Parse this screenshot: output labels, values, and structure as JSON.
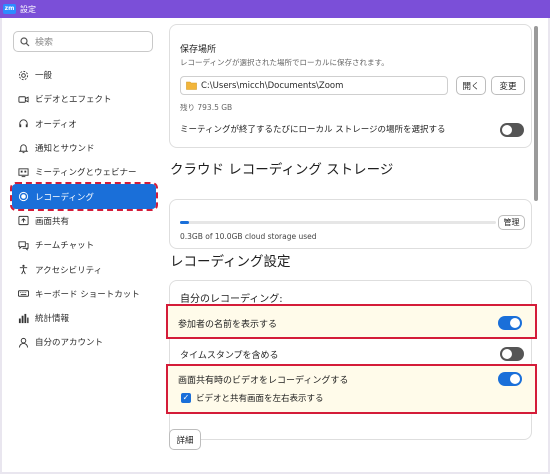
{
  "titlebar": {
    "logo": "zm",
    "title": "設定"
  },
  "sidebar": {
    "search_placeholder": "検索",
    "items": [
      {
        "label": "一般",
        "icon": "gear-icon"
      },
      {
        "label": "ビデオとエフェクト",
        "icon": "video-camera-icon"
      },
      {
        "label": "オーディオ",
        "icon": "headphones-icon"
      },
      {
        "label": "通知とサウンド",
        "icon": "bell-icon"
      },
      {
        "label": "ミーティングとウェビナー",
        "icon": "meeting-icon"
      },
      {
        "label": "レコーディング",
        "icon": "record-icon",
        "active": true
      },
      {
        "label": "画面共有",
        "icon": "screen-share-icon"
      },
      {
        "label": "チームチャット",
        "icon": "chat-icon"
      },
      {
        "label": "アクセシビリティ",
        "icon": "accessibility-icon"
      },
      {
        "label": "キーボード ショートカット",
        "icon": "keyboard-icon"
      },
      {
        "label": "統計情報",
        "icon": "stats-icon"
      },
      {
        "label": "自分のアカウント",
        "icon": "account-icon"
      }
    ]
  },
  "local": {
    "location_label": "保存場所",
    "location_desc": "レコーディングが選択された場所でローカルに保存されます。",
    "path": "C:\\Users\\micch\\Documents\\Zoom",
    "open_button": "開く",
    "change_button": "変更",
    "remaining": "残り 793.5 GB",
    "choose_location_label": "ミーティングが終了するたびにローカル ストレージの場所を選択する",
    "choose_location_on": false
  },
  "cloud": {
    "heading": "クラウド レコーディング ストレージ",
    "usage_text": "0.3GB of 10.0GB cloud storage used",
    "usage_fraction": 0.03,
    "manage_button": "管理"
  },
  "recording": {
    "heading": "レコーディング設定",
    "my_recording": "自分のレコーディング:",
    "show_names_label": "参加者の名前を表示する",
    "show_names_on": true,
    "timestamp_label": "タイムスタンプを含める",
    "timestamp_on": false,
    "screen_share_video_label": "画面共有時のビデオをレコーディングする",
    "screen_share_video_on": true,
    "side_by_side_label": "ビデオと共有画面を左右表示する",
    "side_by_side_checked": true,
    "details_button": "詳細"
  },
  "colors": {
    "accent": "#1a6fd9",
    "highlight": "#d41c39",
    "titlebar": "#7b4fd8"
  }
}
